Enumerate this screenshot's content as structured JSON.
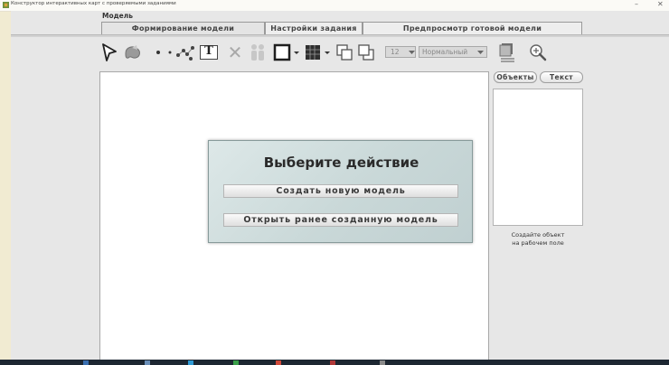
{
  "window": {
    "title": "Конструктор интерактивных карт с проверяемыми заданиями",
    "min_glyph": "–",
    "close_glyph": "✕"
  },
  "menu": {
    "label": "Модель"
  },
  "tabs": [
    {
      "label": "Формирование модели",
      "active": true
    },
    {
      "label": "Настройки задания",
      "active": false
    },
    {
      "label": "Предпросмотр готовой модели",
      "active": false
    }
  ],
  "toolbar": {
    "font_size_value": "12",
    "font_style_value": "Нормальный",
    "text_tool_glyph": "T",
    "delete_glyph": "✕"
  },
  "dialog": {
    "title": "Выберите действие",
    "create_button": "Создать новую модель",
    "open_button": "Открыть ранее созданную модель"
  },
  "right_panel": {
    "tab_objects": "Объекты",
    "tab_text": "Текст",
    "hint_line1": "Создайте объект",
    "hint_line2": "на рабочем поле"
  },
  "colors": {
    "background": "#f1ebd2",
    "app_background": "#e7e7e7",
    "dialog_background": "#c9d8d8",
    "taskbar": "#1d2732"
  }
}
